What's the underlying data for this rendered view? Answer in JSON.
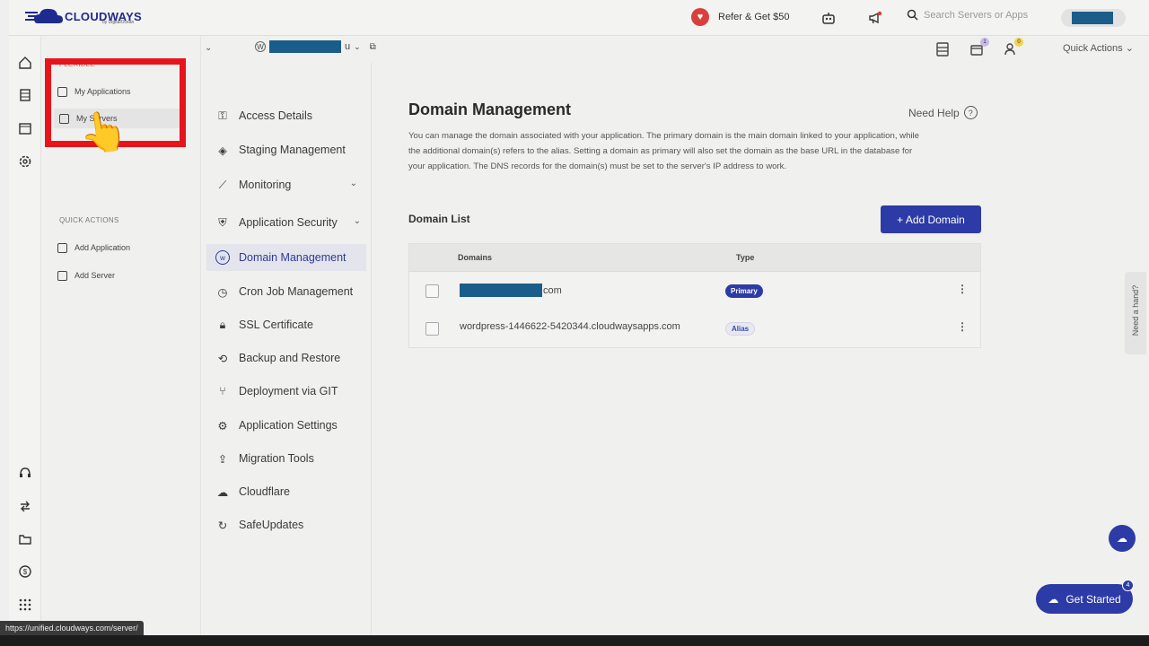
{
  "topbar": {
    "brand": "CLOUDWAYS",
    "brand_sub": "by DigitalOcean",
    "refer_label": "Refer & Get $50",
    "search_placeholder": "Search Servers or Apps"
  },
  "subbar": {
    "app_suffix": "u",
    "quick_actions": "Quick Actions",
    "badges": {
      "apps": "1",
      "team": "0"
    }
  },
  "sidemenu": {
    "section_flexible": "FLEXIBLE",
    "items": [
      {
        "label": "My Applications",
        "icon": "window-icon"
      },
      {
        "label": "My Servers",
        "icon": "server-icon"
      }
    ],
    "section_quick": "QUICK ACTIONS",
    "quick_items": [
      {
        "label": "Add Application",
        "icon": "add-window-icon"
      },
      {
        "label": "Add Server",
        "icon": "add-server-icon"
      }
    ]
  },
  "settings": {
    "items": [
      {
        "label": "Access Details",
        "icon": "key-icon"
      },
      {
        "label": "Staging Management",
        "icon": "layers-icon"
      },
      {
        "label": "Monitoring",
        "icon": "chart-icon"
      },
      {
        "label": "Application Security",
        "icon": "shield-icon"
      },
      {
        "label": "Domain Management",
        "icon": "www-icon"
      },
      {
        "label": "Cron Job Management",
        "icon": "clock-icon"
      },
      {
        "label": "SSL Certificate",
        "icon": "lock-icon"
      },
      {
        "label": "Backup and Restore",
        "icon": "restore-icon"
      },
      {
        "label": "Deployment via GIT",
        "icon": "git-icon"
      },
      {
        "label": "Application Settings",
        "icon": "gear-icon"
      },
      {
        "label": "Migration Tools",
        "icon": "migrate-icon"
      },
      {
        "label": "Cloudflare",
        "icon": "cloud-icon"
      },
      {
        "label": "SafeUpdates",
        "icon": "refresh-icon"
      }
    ]
  },
  "main": {
    "title": "Domain Management",
    "help": "Need Help",
    "description": "You can manage the domain associated with your application. The primary domain is the main domain linked to your application, while the additional domain(s) refers to the alias. Setting a domain as primary will also set the domain as the base URL in the database for your application. The DNS records for the domain(s) must be set to the server's IP address to work.",
    "domain_list_title": "Domain List",
    "add_button": "+ Add Domain",
    "columns": {
      "domains": "Domains",
      "type": "Type"
    },
    "rows": [
      {
        "domain_suffix": "com",
        "type": "Primary"
      },
      {
        "domain": "wordpress-1446622-5420344.cloudwaysapps.com",
        "type": "Alias"
      }
    ]
  },
  "floaters": {
    "need_hand": "Need a hand?",
    "get_started": "Get Started",
    "get_started_badge": "4",
    "status_url": "https://unified.cloudways.com/server/"
  },
  "colors": {
    "accent": "#2d3ba6",
    "highlight_box": "#e8141b",
    "redaction": "#1b5d8a"
  }
}
